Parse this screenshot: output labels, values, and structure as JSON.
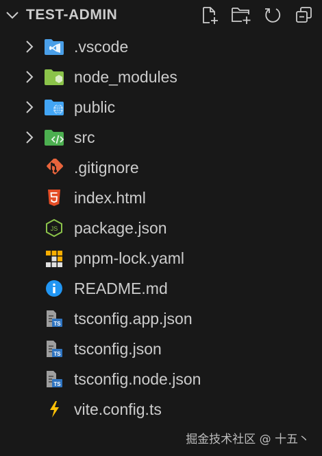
{
  "explorer": {
    "title": "TEST-ADMIN",
    "actions": {
      "new_file": "new-file-icon",
      "new_folder": "new-folder-icon",
      "refresh": "refresh-icon",
      "collapse": "collapse-all-icon"
    }
  },
  "tree": [
    {
      "label": ".vscode",
      "type": "folder",
      "icon": "vscode-folder-icon",
      "color": "#4a9fe8"
    },
    {
      "label": "node_modules",
      "type": "folder",
      "icon": "node-folder-icon",
      "color": "#8bc34a"
    },
    {
      "label": "public",
      "type": "folder",
      "icon": "public-folder-icon",
      "color": "#42a5f5"
    },
    {
      "label": "src",
      "type": "folder",
      "icon": "src-folder-icon",
      "color": "#4caf50"
    },
    {
      "label": ".gitignore",
      "type": "file",
      "icon": "git-icon",
      "color": "#e8643c"
    },
    {
      "label": "index.html",
      "type": "file",
      "icon": "html5-icon",
      "color": "#e44d26"
    },
    {
      "label": "package.json",
      "type": "file",
      "icon": "nodejs-icon",
      "color": "#8bc34a"
    },
    {
      "label": "pnpm-lock.yaml",
      "type": "file",
      "icon": "pnpm-icon",
      "color": "#f9ad00"
    },
    {
      "label": "README.md",
      "type": "file",
      "icon": "info-icon",
      "color": "#2196f3"
    },
    {
      "label": "tsconfig.app.json",
      "type": "file",
      "icon": "tsconfig-icon",
      "color": "#2f74c0"
    },
    {
      "label": "tsconfig.json",
      "type": "file",
      "icon": "tsconfig-icon",
      "color": "#2f74c0"
    },
    {
      "label": "tsconfig.node.json",
      "type": "file",
      "icon": "tsconfig-icon",
      "color": "#2f74c0"
    },
    {
      "label": "vite.config.ts",
      "type": "file",
      "icon": "vite-icon",
      "color": "#ffc107"
    }
  ],
  "watermark": "掘金技术社区 @ 十五丶"
}
